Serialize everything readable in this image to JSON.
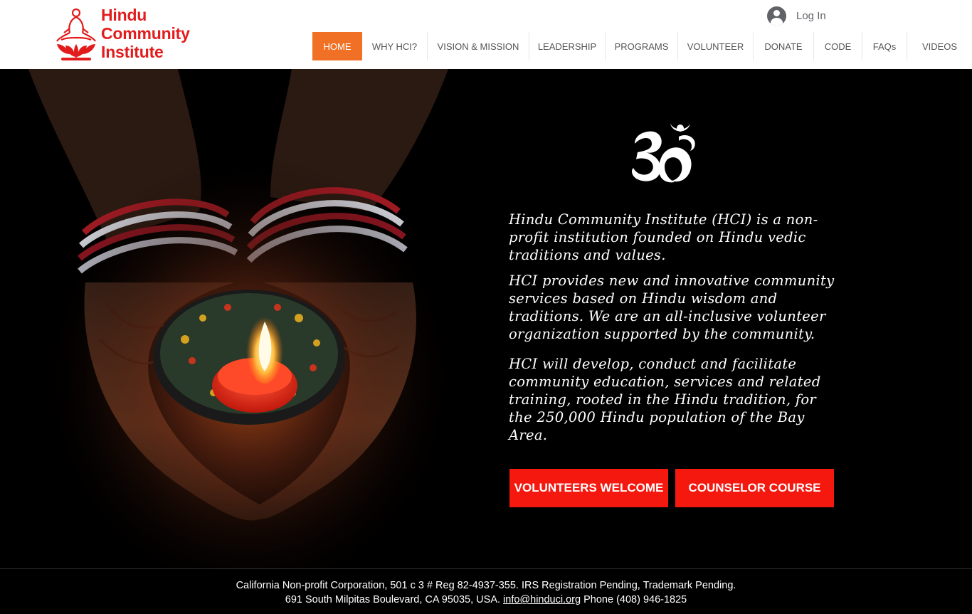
{
  "brand": {
    "line1": "Hindu",
    "line2": "Community",
    "line3": "Institute",
    "color": "#e21c1c"
  },
  "header": {
    "login_label": "Log In",
    "login_icon": "user-avatar-icon"
  },
  "nav": {
    "items": [
      "HOME",
      "WHY HCI?",
      "VISION & MISSION",
      "LEADERSHIP",
      "PROGRAMS",
      "VOLUNTEER",
      "DONATE",
      "CODE",
      "FAQs",
      "VIDEOS"
    ],
    "active": "HOME",
    "active_color": "#f07125"
  },
  "hero": {
    "symbol": "om-icon",
    "paragraphs": [
      "Hindu Community Institute (HCI) is a non-profit institution founded on Hindu vedic traditions and values.",
      "HCI provides new and innovative community services based on Hindu wisdom and traditions. We are an all-inclusive volunteer organization supported by the community.",
      "HCI will develop, conduct and facilitate community education, services and related training, rooted in the Hindu tradition, for the 250,000 Hindu population of the Bay Area."
    ],
    "buttons": {
      "volunteers": "VOLUNTEERS WELCOME",
      "course": "COUNSELOR COURSE"
    },
    "button_color": "#f5180f"
  },
  "footer": {
    "line1": "California Non-profit Corporation, 501 c 3 # Reg 82-4937-355. IRS Registration Pending, Trademark Pending.",
    "address": "691 South Milpitas Boulevard, CA 95035, USA.",
    "email": "info@hinduci.org",
    "phone": "Phone (408) 946-1825"
  }
}
